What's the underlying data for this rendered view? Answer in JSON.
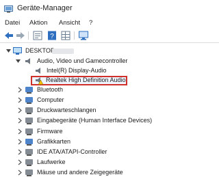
{
  "window": {
    "title": "Geräte-Manager",
    "icon": "device-manager-icon"
  },
  "menu": [
    "Datei",
    "Aktion",
    "Ansicht",
    "?"
  ],
  "toolbar": [
    "back-arrow-icon",
    "forward-arrow-icon",
    "properties-icon",
    "help-icon",
    "grid-icon",
    "monitor-icon"
  ],
  "tree": {
    "root": "DESKTOP-",
    "audio_category": "Audio, Video und Gamecontroller",
    "audio_children": [
      "Intel(R) Display-Audio",
      "Realtek High Definition Audio"
    ],
    "categories": [
      "Bluetooth",
      "Computer",
      "Druckwarteschlangen",
      "Eingabegeräte (Human Interface Devices)",
      "Firmware",
      "Grafikkarten",
      "IDE ATA/ATAPI-Controller",
      "Laufwerke",
      "Mäuse und andere Zeigegeräte"
    ]
  },
  "colors": {
    "highlight_border": "#d0302a",
    "icon_blue": "#2f6fc0"
  }
}
